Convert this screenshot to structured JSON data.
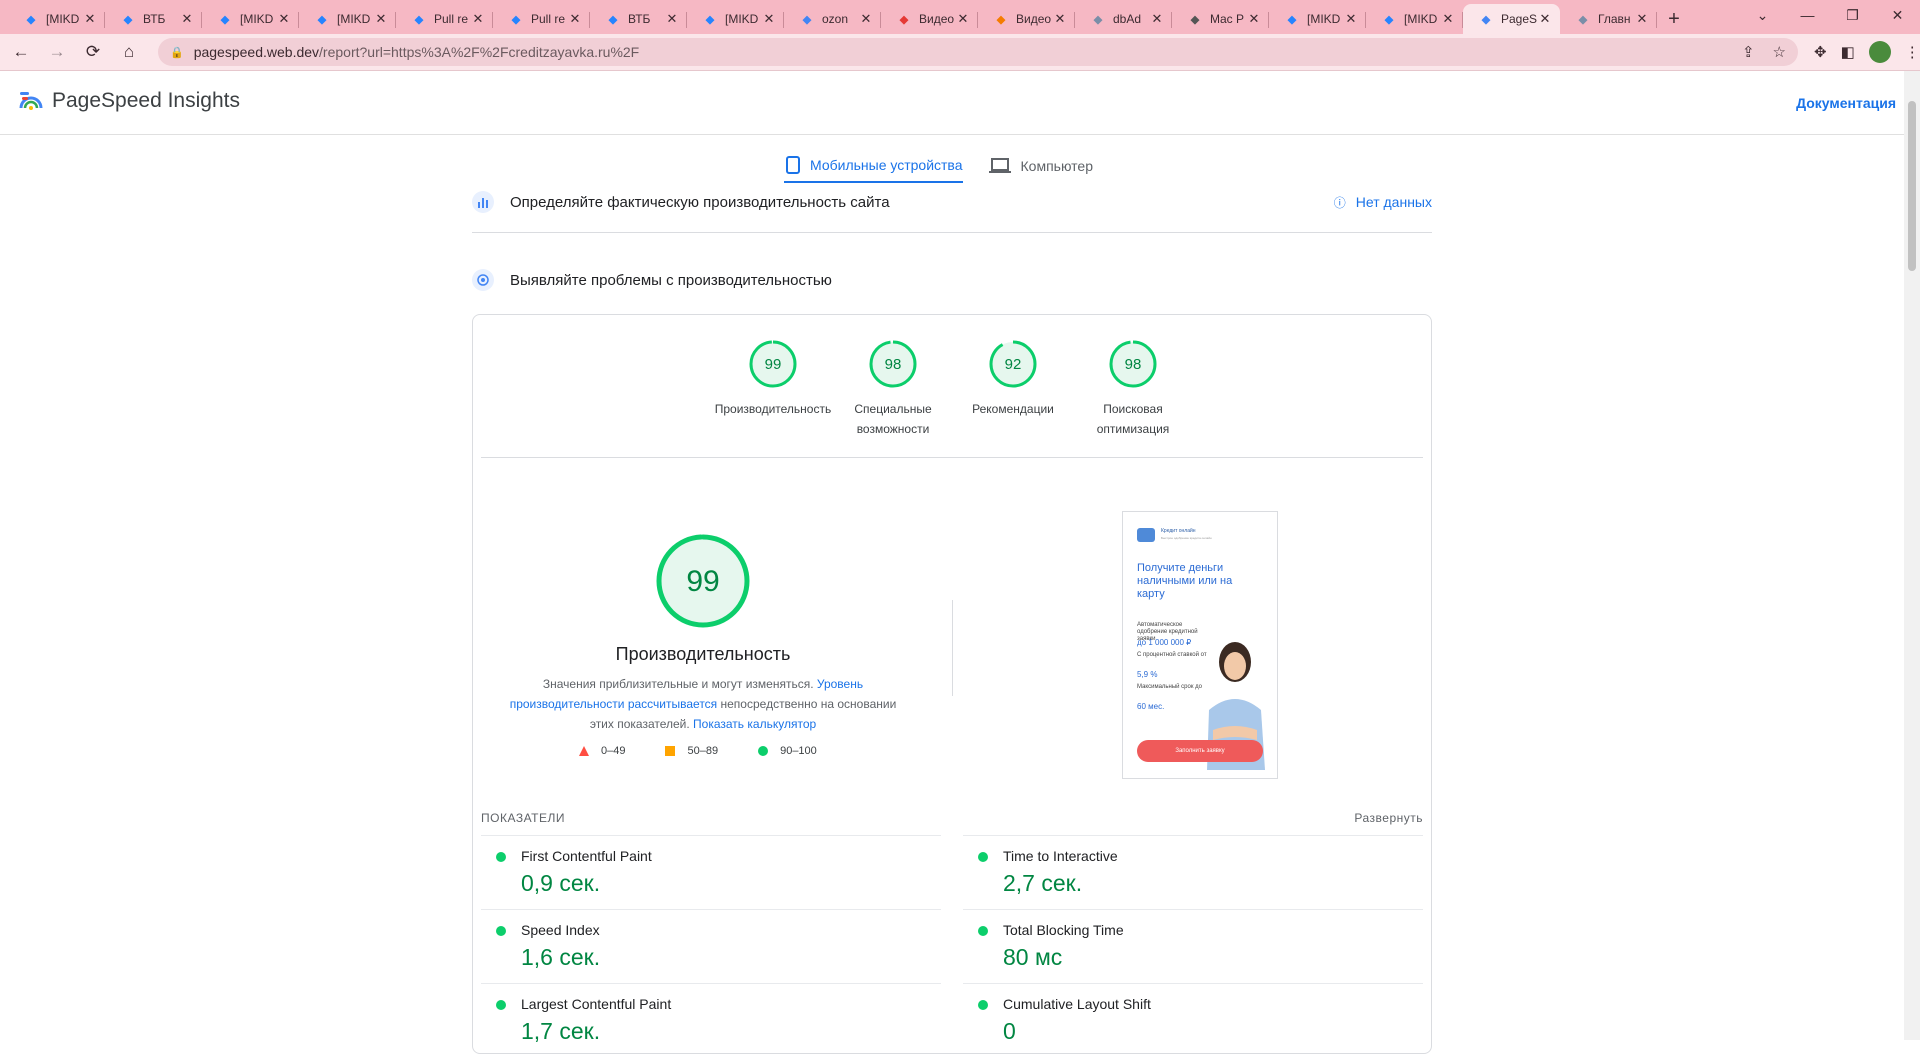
{
  "browser": {
    "tabs": [
      {
        "title": "[MIKD",
        "icon": "jira-icon",
        "color": "#2684ff"
      },
      {
        "title": "ВТБ",
        "icon": "docs-icon",
        "color": "#2684ff"
      },
      {
        "title": "[MIKD",
        "icon": "jira-icon",
        "color": "#2684ff"
      },
      {
        "title": "[MIKD",
        "icon": "jira-icon",
        "color": "#2684ff"
      },
      {
        "title": "Pull re",
        "icon": "bitbucket-icon",
        "color": "#2684ff"
      },
      {
        "title": "Pull re",
        "icon": "bitbucket-icon",
        "color": "#2684ff"
      },
      {
        "title": "ВТБ",
        "icon": "docs-icon",
        "color": "#2684ff"
      },
      {
        "title": "[MIKD",
        "icon": "jira-icon",
        "color": "#2684ff"
      },
      {
        "title": "ozon",
        "icon": "google-icon",
        "color": "#4285f4"
      },
      {
        "title": "Видео",
        "icon": "video-icon",
        "color": "#e53935"
      },
      {
        "title": "Видео",
        "icon": "dns-icon",
        "color": "#f57c00"
      },
      {
        "title": "dbAd",
        "icon": "page-icon",
        "color": "#7a8ea8"
      },
      {
        "title": "Mac P",
        "icon": "apple-icon",
        "color": "#555555"
      },
      {
        "title": "[MIKD",
        "icon": "jira-icon",
        "color": "#2684ff"
      },
      {
        "title": "[MIKD",
        "icon": "jira-icon",
        "color": "#2684ff"
      },
      {
        "title": "PageS",
        "icon": "pagespeed-icon",
        "color": "#4285f4",
        "active": true
      },
      {
        "title": "Главн",
        "icon": "page-icon",
        "color": "#7a8ea8"
      }
    ],
    "url_host": "pagespeed.web.dev",
    "url_path": "/report?url=https%3A%2F%2Fcreditzayavka.ru%2F"
  },
  "header": {
    "brand": "PageSpeed Insights",
    "docs_link": "Документация"
  },
  "device_tabs": {
    "mobile": "Мобильные устройства",
    "desktop": "Компьютер"
  },
  "field_section": {
    "label": "Определяйте фактическую производительность сайта",
    "status": "Нет данных"
  },
  "lab_section": {
    "label": "Выявляйте проблемы с производительностью"
  },
  "scores": [
    {
      "value": 99,
      "label_lines": [
        "Производительность"
      ]
    },
    {
      "value": 98,
      "label_lines": [
        "Специальные",
        "возможности"
      ]
    },
    {
      "value": 92,
      "label_lines": [
        "Рекомендации"
      ]
    },
    {
      "value": 98,
      "label_lines": [
        "Поисковая",
        "оптимизация"
      ]
    }
  ],
  "performance": {
    "score": 99,
    "title": "Производительность",
    "note_part1": "Значения приблизительные и могут изменяться. ",
    "note_link1": "Уровень производительности рассчитывается",
    "note_part2": " непосредственно на основании этих показателей. ",
    "note_link2": "Показать калькулятор",
    "legend": {
      "bad": "0–49",
      "avg": "50–89",
      "good": "90–100"
    },
    "colors": {
      "good": "#0cce6b",
      "avg": "#ffa400",
      "bad": "#ff4e42"
    }
  },
  "screenshot": {
    "brand": "Кредит онлайн",
    "sub": "Быстрое одобрение кредита онлайн",
    "headline": "Получите деньги наличными или на карту",
    "facts": [
      {
        "label": "Автоматическое одобрение кредитной заявки",
        "value": "до 1 000 000 ₽"
      },
      {
        "label": "С процентной ставкой от",
        "value": "5,9 %"
      },
      {
        "label": "Максимальный срок до",
        "value": "60 мес."
      }
    ],
    "button": "Заполнить заявку"
  },
  "metrics": {
    "header": "ПОКАЗАТЕЛИ",
    "expand": "Развернуть",
    "left": [
      {
        "name": "First Contentful Paint",
        "value": "0,9 сек."
      },
      {
        "name": "Speed Index",
        "value": "1,6 сек."
      },
      {
        "name": "Largest Contentful Paint",
        "value": "1,7 сек."
      }
    ],
    "right": [
      {
        "name": "Time to Interactive",
        "value": "2,7 сек."
      },
      {
        "name": "Total Blocking Time",
        "value": "80 мс"
      },
      {
        "name": "Cumulative Layout Shift",
        "value": "0"
      }
    ]
  }
}
